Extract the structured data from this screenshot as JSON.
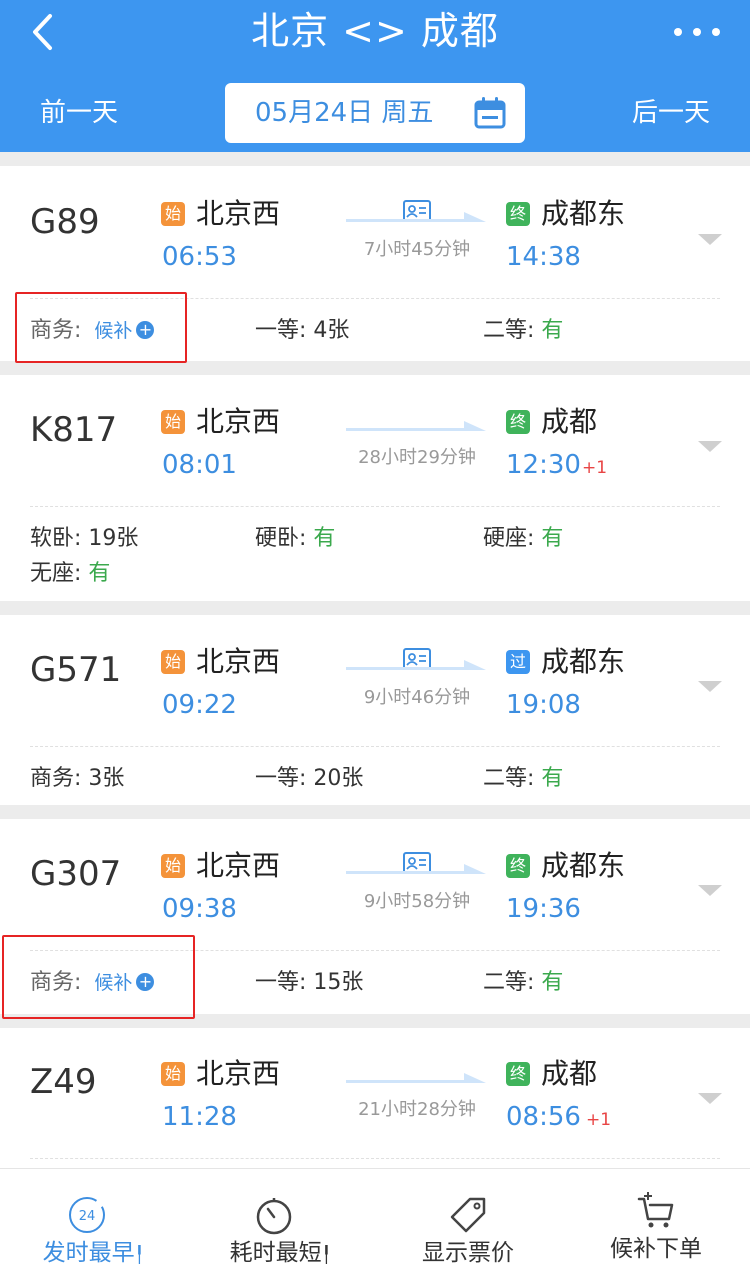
{
  "header": {
    "title": "北京 <> 成都",
    "prev_day": "前一天",
    "next_day": "后一天",
    "date": "05月24日 周五",
    "bg_color": "#3d96f0"
  },
  "badges": {
    "start": "始",
    "end": "终",
    "pass": "过"
  },
  "trains": [
    {
      "no": "G89",
      "from": "北京西",
      "dep": "06:53",
      "to": "成都东",
      "arr": "14:38",
      "arr_badge": "终",
      "duration": "7小时45分钟",
      "next_day": "",
      "seats": [
        {
          "label": "商务:",
          "value": "候补",
          "waitlist": true
        },
        {
          "label": "一等:",
          "value": "4张"
        },
        {
          "label": "二等:",
          "value": "有",
          "green": true
        }
      ]
    },
    {
      "no": "K817",
      "from": "北京西",
      "dep": "08:01",
      "to": "成都",
      "arr": "12:30",
      "arr_badge": "终",
      "duration": "28小时29分钟",
      "next_day": "+1",
      "seats": [
        {
          "label": "软卧:",
          "value": "19张"
        },
        {
          "label": "硬卧:",
          "value": "有",
          "green": true
        },
        {
          "label": "硬座:",
          "value": "有",
          "green": true
        },
        {
          "label": "无座:",
          "value": "有",
          "green": true
        }
      ]
    },
    {
      "no": "G571",
      "from": "北京西",
      "dep": "09:22",
      "to": "成都东",
      "arr": "19:08",
      "arr_badge": "过",
      "duration": "9小时46分钟",
      "next_day": "",
      "seats": [
        {
          "label": "商务:",
          "value": "3张"
        },
        {
          "label": "一等:",
          "value": "20张"
        },
        {
          "label": "二等:",
          "value": "有",
          "green": true
        }
      ]
    },
    {
      "no": "G307",
      "from": "北京西",
      "dep": "09:38",
      "to": "成都东",
      "arr": "19:36",
      "arr_badge": "终",
      "duration": "9小时58分钟",
      "next_day": "",
      "seats": [
        {
          "label": "商务:",
          "value": "候补",
          "waitlist": true
        },
        {
          "label": "一等:",
          "value": "15张"
        },
        {
          "label": "二等:",
          "value": "有",
          "green": true
        }
      ]
    },
    {
      "no": "Z49",
      "from": "北京西",
      "dep": "11:28",
      "to": "成都",
      "arr": "08:56",
      "arr_badge": "终",
      "duration": "21小时28分钟",
      "next_day": "+1"
    }
  ],
  "bottom_tabs": [
    {
      "label": "发时最早",
      "icon": "clock-24-icon",
      "active": true,
      "sortable": true,
      "icon_text": "24"
    },
    {
      "label": "耗时最短",
      "icon": "stopwatch-icon",
      "active": false,
      "sortable": true
    },
    {
      "label": "显示票价",
      "icon": "price-tag-icon",
      "active": false,
      "sortable": false
    },
    {
      "label": "候补下单",
      "icon": "cart-add-icon",
      "active": false,
      "sortable": false
    }
  ]
}
